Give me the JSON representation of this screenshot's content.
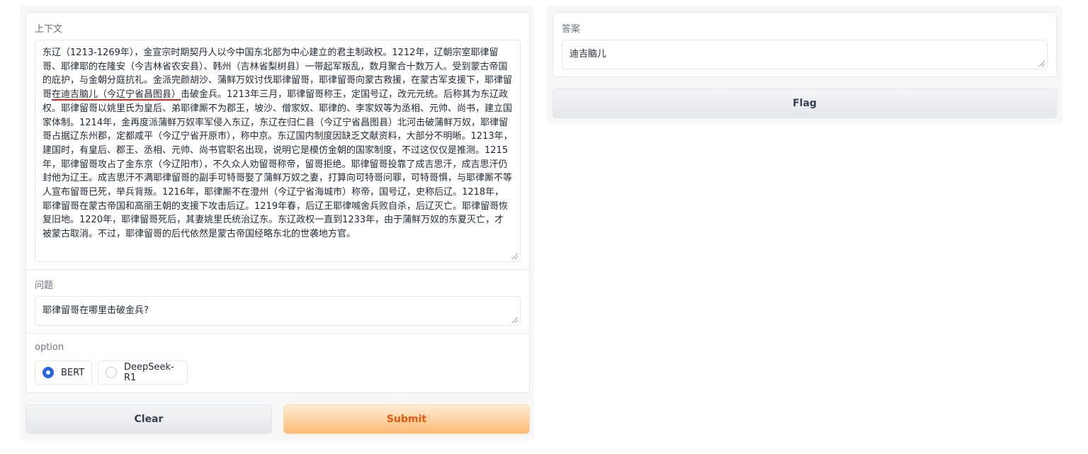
{
  "context": {
    "label": "上下文",
    "before_underline": "东辽（1213-1269年），金宣宗时期契丹人以今中国东北部为中心建立的君主制政权。1212年，辽朝宗室耶律留哥、耶律耶的在隆安（今吉林省农安县）、韩州（吉林省梨树县）一带起军叛乱，数月聚合十数万人。受到蒙古帝国的庇护，与金朝分庭抗礼。金派完颜胡沙、蒲鲜万奴讨伐耶律留哥，耶律留哥向蒙古救援，在蒙古军支援下，耶律留哥",
    "underlined": "在迪吉脑儿（今辽宁省昌图县）",
    "after_underline": "击破金兵。1213年三月，耶律留哥称王，定国号辽，改元元统。后称其为东辽政权。耶律留哥以姚里氏为皇后、弟耶律厮不为郡王，坡沙、僧家奴、耶律的、李家奴等为丞相、元帅、尚书，建立国家体制。1214年，金再度派蒲鲜万奴率军侵入东辽，东辽在归仁县（今辽宁省昌图县）北河击破蒲鲜万奴，耶律留哥占据辽东州郡，定都咸平（今辽宁省开原市），称中京。东辽国内制度因缺乏文献资料，大部分不明晰。1213年，建国时，有皇后、郡王、丞相、元帅、尚书官职名出现，说明它是模仿金朝的国家制度，不过这仅仅是推测。1215年，耶律留哥攻占了金东京（今辽阳市），不久众人劝留哥称帝，留哥拒绝。耶律留哥投靠了成吉思汗，成吉思汗仍封他为辽王。成吉思汗不满耶律留哥的副手可特哥娶了蒲鲜万奴之妻，打算向可特哥问罪，可特哥惧，与耶律厮不等人宣布留哥已死，举兵背叛。1216年，耶律厮不在澄州（今辽宁省海城市）称帝，国号辽，史称后辽。1218年，耶律留哥在蒙古帝国和高丽王朝的支援下攻击后辽。1219年春，后辽王耶律喊舍兵败自杀，后辽灭亡。耶律留哥恢复旧地。1220年，耶律留哥死后，其妻姚里氏统治辽东。东辽政权一直到1233年，由于蒲鲜万奴的东夏灭亡，才被蒙古取消。不过，耶律留哥的后代依然是蒙古帝国经略东北的世袭地方官。"
  },
  "question": {
    "label": "问题",
    "value": "耶律留哥在哪里击破金兵?"
  },
  "option": {
    "label": "option",
    "choices": [
      "BERT",
      "DeepSeek-R1"
    ],
    "selected": "BERT"
  },
  "buttons": {
    "clear": "Clear",
    "submit": "Submit",
    "flag": "Flag"
  },
  "answer": {
    "label": "答案",
    "value": "迪吉脑儿"
  },
  "colors": {
    "primary_text": "#ea580c",
    "primary_bg": "#fdba74",
    "radio_selected": "#2563eb",
    "underline": "#dc2626"
  }
}
